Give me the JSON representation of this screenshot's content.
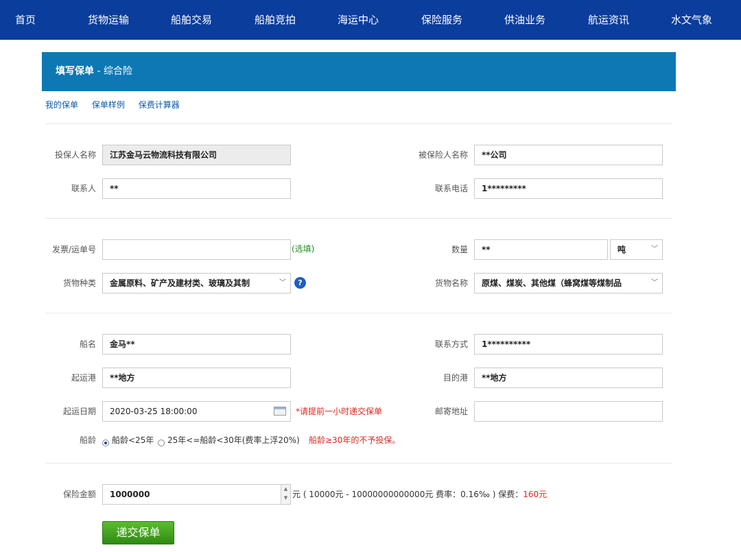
{
  "nav": {
    "items": [
      "首页",
      "货物运输",
      "船舶交易",
      "船舶竞拍",
      "海运中心",
      "保险服务",
      "供油业务",
      "航运资讯",
      "水文气象"
    ]
  },
  "header": {
    "title_bold": "填写保单",
    "title_rest": " - 综合险"
  },
  "sublinks": [
    "我的保单",
    "保单样例",
    "保费计算器"
  ],
  "form": {
    "policyholder": {
      "label": "投保人名称",
      "value": "江苏金马云物流科技有限公司"
    },
    "insured": {
      "label": "被保险人名称",
      "value": "**公司"
    },
    "contact": {
      "label": "联系人",
      "value": "**"
    },
    "phone": {
      "label": "联系电话",
      "value": "1*********"
    },
    "invoice": {
      "label": "发票/运单号",
      "value": "",
      "hint": "(选填)"
    },
    "quantity": {
      "label": "数量",
      "value": "**",
      "unit": "吨"
    },
    "cargo_type": {
      "label": "货物种类",
      "value": "金属原料、矿产及建材类、玻璃及其制"
    },
    "cargo_name": {
      "label": "货物名称",
      "value": "原煤、煤炭、其他煤（蜂窝煤等煤制品"
    },
    "ship_name": {
      "label": "船名",
      "value": "金马**"
    },
    "contact_method": {
      "label": "联系方式",
      "value": "1**********"
    },
    "departure_port": {
      "label": "起运港",
      "value": "**地方"
    },
    "destination_port": {
      "label": "目的港",
      "value": "**地方"
    },
    "departure_date": {
      "label": "起运日期",
      "value": "2020-03-25 18:00:00",
      "hint": "*请提前一小时递交保单"
    },
    "mail_address": {
      "label": "邮寄地址",
      "value": ""
    },
    "ship_age": {
      "label": "船龄",
      "options": [
        "船龄<25年",
        "25年<=船龄<30年(费率上浮20%)"
      ],
      "selected": 0,
      "note": "船龄≥30年的不予投保。"
    },
    "amount": {
      "label": "保险金额",
      "value": "1000000",
      "desc": "元 ( 10000元 - 10000000000000元   费率：0.16‰ )  保费：",
      "premium": "160元"
    }
  },
  "submit_label": "递交保单"
}
